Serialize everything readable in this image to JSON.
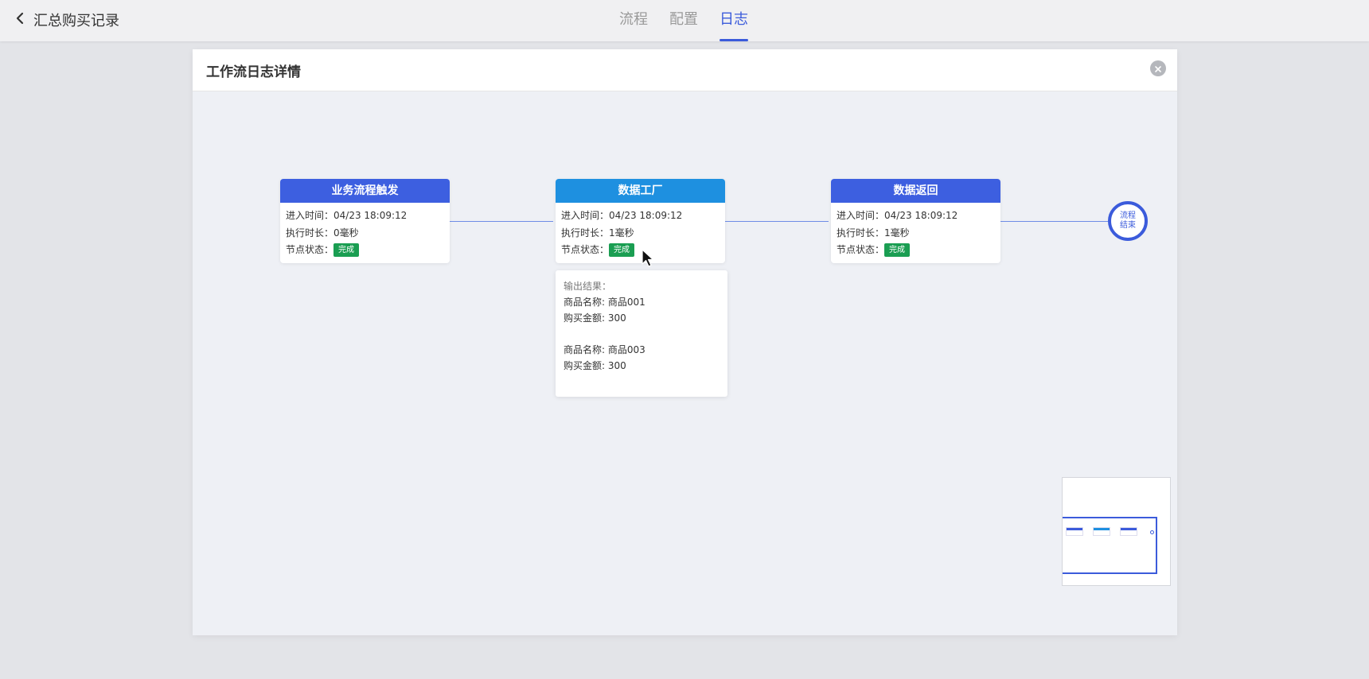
{
  "header": {
    "title": "汇总购买记录",
    "tabs": [
      {
        "label": "流程",
        "active": false
      },
      {
        "label": "配置",
        "active": false
      },
      {
        "label": "日志",
        "active": true
      }
    ]
  },
  "modal": {
    "title": "工作流日志详情"
  },
  "colors": {
    "accent": "#3b5bdb",
    "node_header_blue": "#3d5fe0",
    "node_header_lightblue": "#1e90e0",
    "status_green": "#1a9e52"
  },
  "nodes": [
    {
      "title": "业务流程触发",
      "enter_time_label": "进入时间：",
      "enter_time": "04/23 18:09:12",
      "duration_label": "执行时长：",
      "duration": "0毫秒",
      "status_label": "节点状态：",
      "status": "完成"
    },
    {
      "title": "数据工厂",
      "enter_time_label": "进入时间：",
      "enter_time": "04/23 18:09:12",
      "duration_label": "执行时长：",
      "duration": "1毫秒",
      "status_label": "节点状态：",
      "status": "完成"
    },
    {
      "title": "数据返回",
      "enter_time_label": "进入时间：",
      "enter_time": "04/23 18:09:12",
      "duration_label": "执行时长：",
      "duration": "1毫秒",
      "status_label": "节点状态：",
      "status": "完成"
    }
  ],
  "end_node": {
    "line1": "流程",
    "line2": "结束"
  },
  "tooltip": {
    "label": "输出结果：",
    "lines": [
      "商品名称: 商品001",
      "购买金额: 300",
      "",
      "商品名称: 商品003",
      "购买金额: 300"
    ]
  }
}
